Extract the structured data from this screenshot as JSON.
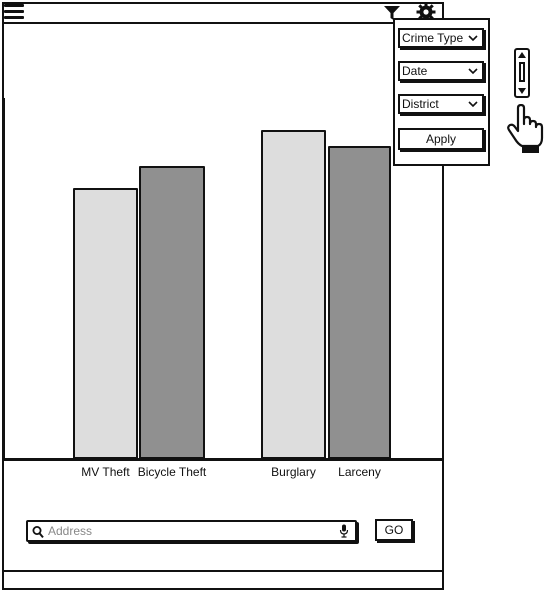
{
  "header": {
    "menu_icon": "hamburger-icon",
    "filter_icon": "filter-icon",
    "settings_icon": "gear-icon"
  },
  "chart_data": {
    "type": "bar",
    "categories": [
      "MV Theft",
      "Bicycle Theft",
      "Burglary",
      "Larceny"
    ],
    "values": [
      270,
      292,
      328,
      312
    ],
    "ylim": [
      0,
      360
    ],
    "colors": [
      "#dddddd",
      "#909090",
      "#dddddd",
      "#909090"
    ],
    "grid": false
  },
  "filters": {
    "crime_type_label": "Crime Type",
    "date_label": "Date",
    "district_label": "District",
    "apply_label": "Apply"
  },
  "search": {
    "placeholder": "Address",
    "value": "",
    "go_label": "GO",
    "search_icon": "search-icon",
    "mic_icon": "microphone-icon"
  },
  "side": {
    "scrollbar_icon": "scrollbar",
    "hand_icon": "pointer-hand-icon"
  }
}
